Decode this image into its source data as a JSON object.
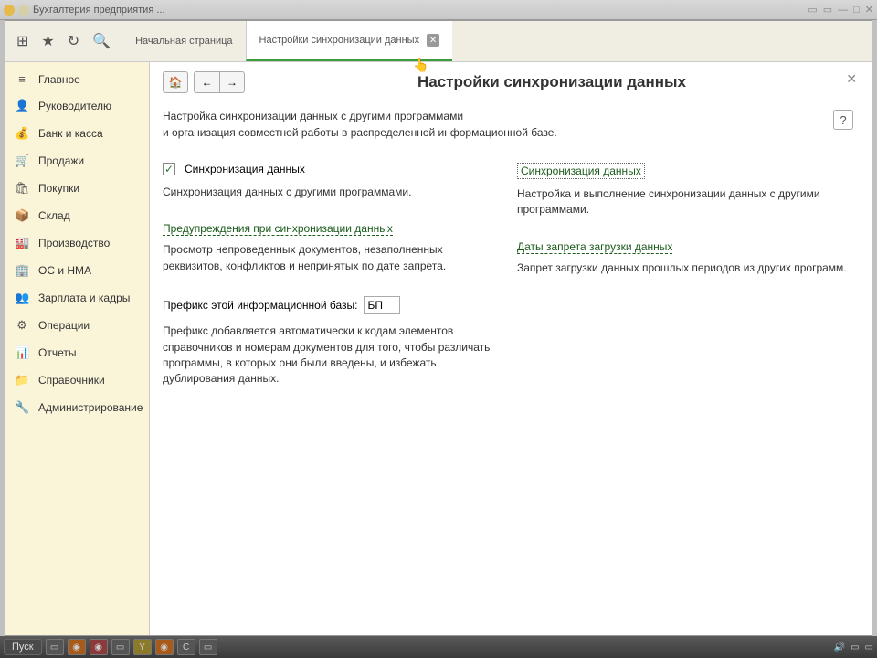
{
  "titlebar": {
    "text": "Бухгалтерия предприятия ..."
  },
  "toolbar": {
    "tabs": [
      {
        "label": "Начальная страница"
      },
      {
        "label": "Настройки синхронизации данных"
      }
    ]
  },
  "sidebar": {
    "items": [
      {
        "icon": "≡",
        "label": "Главное"
      },
      {
        "icon": "👤",
        "label": "Руководителю"
      },
      {
        "icon": "💰",
        "label": "Банк и касса"
      },
      {
        "icon": "🛒",
        "label": "Продажи"
      },
      {
        "icon": "🛍",
        "label": "Покупки"
      },
      {
        "icon": "📦",
        "label": "Склад"
      },
      {
        "icon": "🏭",
        "label": "Производство"
      },
      {
        "icon": "🏢",
        "label": "ОС и НМА"
      },
      {
        "icon": "👥",
        "label": "Зарплата и кадры"
      },
      {
        "icon": "⚙",
        "label": "Операции"
      },
      {
        "icon": "📊",
        "label": "Отчеты"
      },
      {
        "icon": "📁",
        "label": "Справочники"
      },
      {
        "icon": "🔧",
        "label": "Администрирование"
      }
    ]
  },
  "page": {
    "title": "Настройки синхронизации данных",
    "desc_line1": "Настройка синхронизации данных с другими программами",
    "desc_line2": "и организация совместной работы в распределенной информационной базе.",
    "checkbox_label": "Синхронизация данных",
    "sync_desc": "Синхронизация данных с другими программами.",
    "link_sync": "Синхронизация данных",
    "sync_right_desc": "Настройка и выполнение синхронизации данных с другими программами.",
    "link_warnings": "Предупреждения при синхронизации данных",
    "warnings_desc": "Просмотр непроведенных документов, незаполненных реквизитов, конфликтов и непринятых по дате запрета.",
    "link_dates": "Даты запрета загрузки данных",
    "dates_desc": "Запрет загрузки данных прошлых периодов из других программ.",
    "prefix_label": "Префикс этой информационной базы:",
    "prefix_value": "БП",
    "prefix_desc": "Префикс добавляется автоматически к кодам элементов справочников и номерам документов для того, чтобы различать программы, в которых они были введены, и избежать дублирования данных."
  },
  "taskbar": {
    "start": "Пуск"
  }
}
